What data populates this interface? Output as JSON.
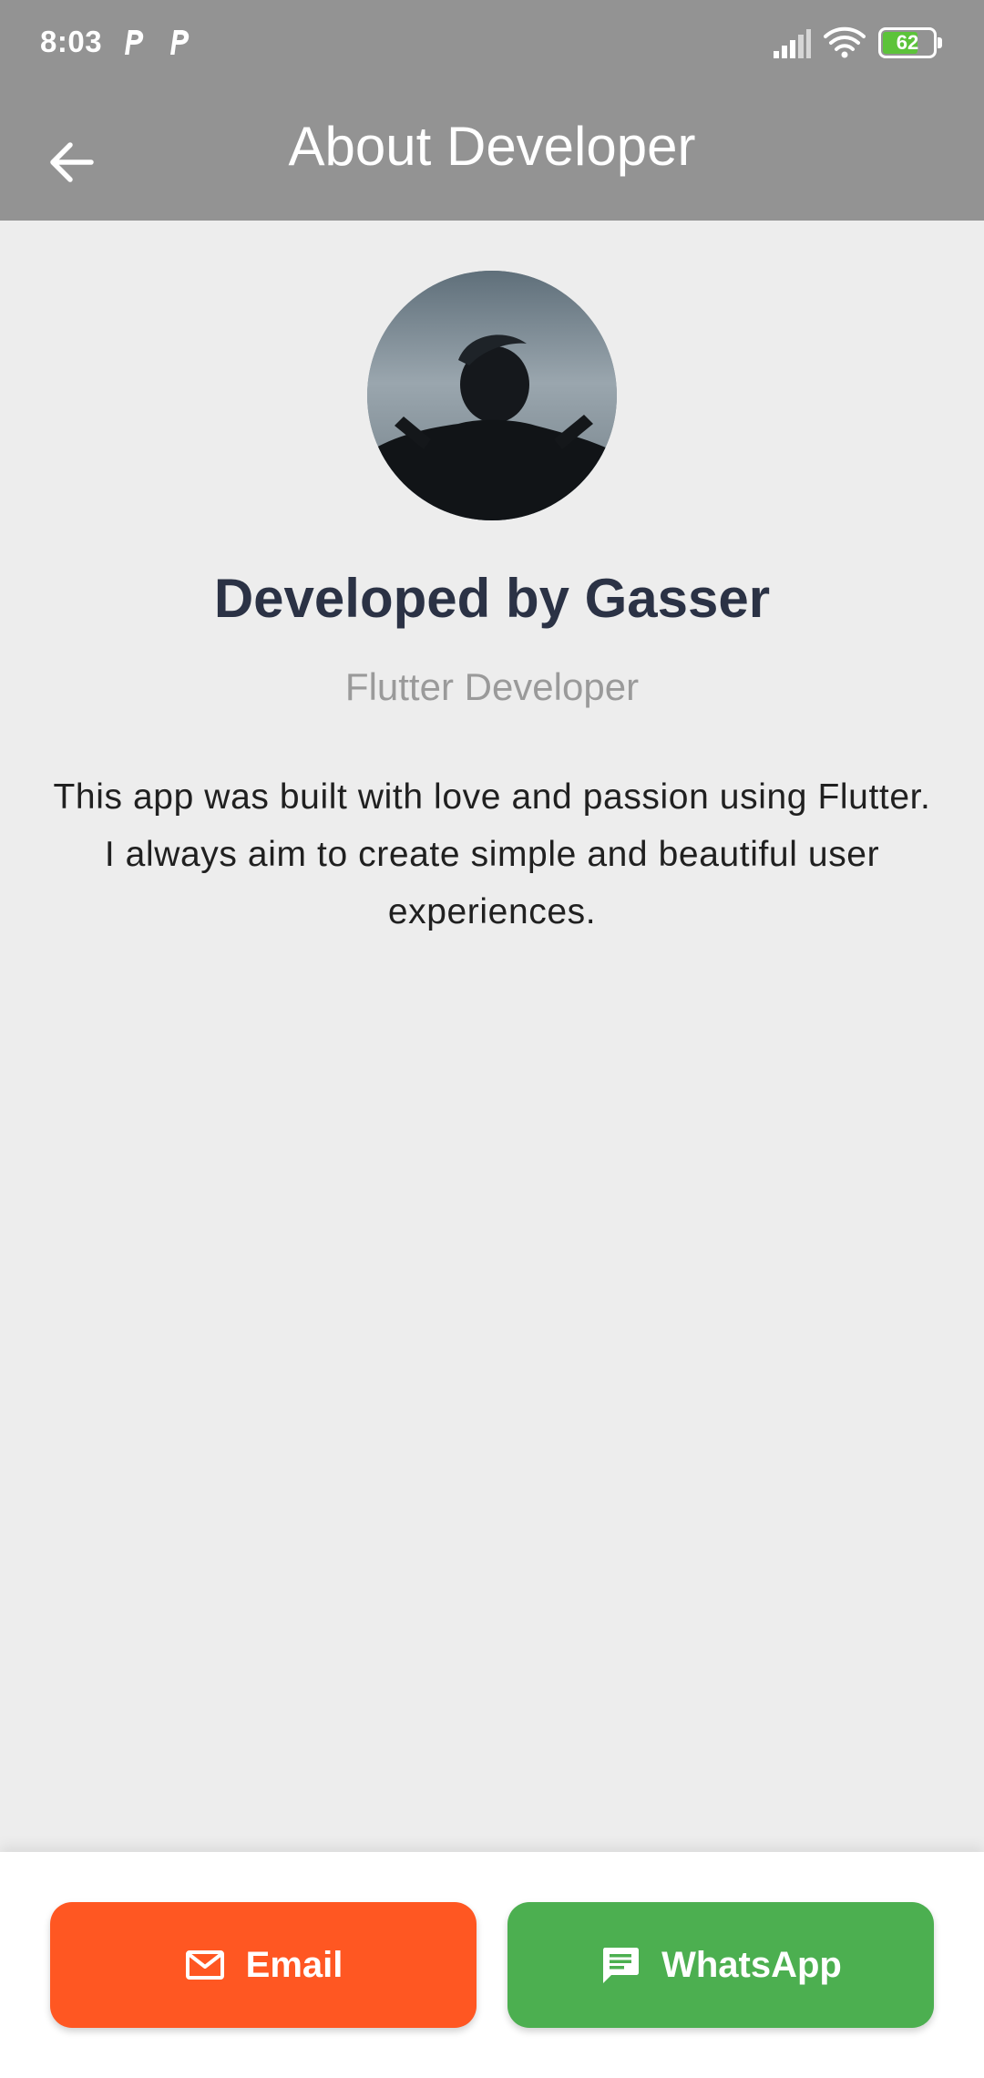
{
  "status_bar": {
    "time": "8:03",
    "notification_icons": [
      "parking-p-icon",
      "parking-p-icon"
    ],
    "signal_icon": "cell-signal-icon",
    "wifi_icon": "wifi-icon",
    "battery_level": "62",
    "battery_color": "#5cc33a"
  },
  "app_bar": {
    "back_icon": "arrow-back-icon",
    "title": "About Developer",
    "background": "#939393"
  },
  "profile": {
    "avatar_icon": "developer-photo",
    "name": "Developed by Gasser",
    "role": "Flutter Developer",
    "bio": "This app was built with love and passion using Flutter. I always aim to create simple and beautiful user experiences."
  },
  "actions": {
    "email": {
      "label": "Email",
      "icon": "mail-icon",
      "color": "#ff5722"
    },
    "whatsapp": {
      "label": "WhatsApp",
      "icon": "chat-icon",
      "color": "#4caf50"
    }
  }
}
